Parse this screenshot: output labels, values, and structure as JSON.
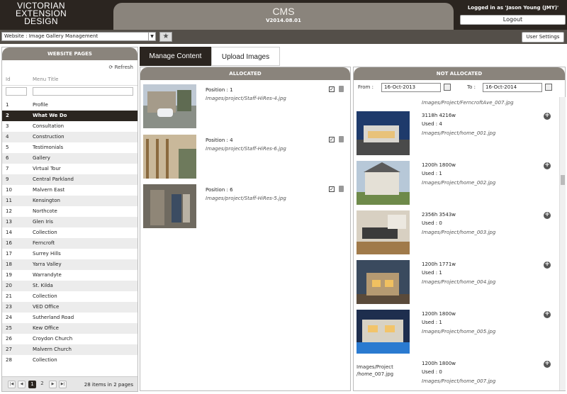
{
  "header": {
    "logo_lines": [
      "VICTORIAN",
      "EXTENSION",
      "DESIGN"
    ],
    "title": "CMS",
    "version": "V2014.08.01",
    "login_text": "Logged in as 'Jason Young (JMY)'",
    "logout_label": "Logout"
  },
  "toolbar": {
    "website_select": "Website : Image Gallery Management",
    "user_settings_label": "User Settings"
  },
  "left_panel": {
    "title": "WEBSITE PAGES",
    "refresh_label": "Refresh",
    "col_id": "Id",
    "col_title": "Menu Title",
    "rows": [
      {
        "id": "1",
        "title": "Profile"
      },
      {
        "id": "2",
        "title": "What We Do"
      },
      {
        "id": "3",
        "title": "Consultation"
      },
      {
        "id": "4",
        "title": "Construction"
      },
      {
        "id": "5",
        "title": "Testimonials"
      },
      {
        "id": "6",
        "title": "Gallery"
      },
      {
        "id": "7",
        "title": "Virtual Tour"
      },
      {
        "id": "9",
        "title": "Central Parkland"
      },
      {
        "id": "10",
        "title": "Malvern East"
      },
      {
        "id": "11",
        "title": "Kensington"
      },
      {
        "id": "12",
        "title": "Northcote"
      },
      {
        "id": "13",
        "title": "Glen Iris"
      },
      {
        "id": "14",
        "title": "Collection"
      },
      {
        "id": "16",
        "title": "Ferncroft"
      },
      {
        "id": "17",
        "title": "Surrey Hills"
      },
      {
        "id": "18",
        "title": "Yarra Valley"
      },
      {
        "id": "19",
        "title": "Warrandyte"
      },
      {
        "id": "20",
        "title": "St. Kilda"
      },
      {
        "id": "21",
        "title": "Collection"
      },
      {
        "id": "23",
        "title": "VED Office"
      },
      {
        "id": "24",
        "title": "Sutherland Road"
      },
      {
        "id": "25",
        "title": "Kew Office"
      },
      {
        "id": "26",
        "title": "Croydon Church"
      },
      {
        "id": "27",
        "title": "Malvern Church"
      },
      {
        "id": "28",
        "title": "Collection"
      }
    ],
    "selected_id": "2",
    "pager": {
      "pages": [
        "1",
        "2"
      ],
      "current": "1",
      "info": "28 items in 2 pages"
    }
  },
  "tabs": [
    {
      "label": "Manage Content"
    },
    {
      "label": "Upload Images"
    }
  ],
  "allocated": {
    "title": "ALLOCATED",
    "items": [
      {
        "position": "Position : 1",
        "path": "Images/project/Staff-HiRes-4.jpg"
      },
      {
        "position": "Position : 4",
        "path": "Images/project/Staff-HiRes-6.jpg"
      },
      {
        "position": "Position : 6",
        "path": "Images/project/Staff-HiRes-5.jpg"
      }
    ]
  },
  "not_allocated": {
    "title": "NOT ALLOCATED",
    "from_label": "From :",
    "from_date": "16-Oct-2013",
    "to_label": "To :",
    "to_date": "16-Oct-2014",
    "top_partial_path": "Images/Project/FerncroftAve_007.jpg",
    "items": [
      {
        "dims": "3118h 4216w",
        "used": "Used : 4",
        "path": "Images/Project/home_001.jpg"
      },
      {
        "dims": "1200h 1800w",
        "used": "Used : 1",
        "path": "Images/Project/home_002.jpg"
      },
      {
        "dims": "2356h 3543w",
        "used": "Used : 0",
        "path": "Images/Project/home_003.jpg"
      },
      {
        "dims": "1200h 1771w",
        "used": "Used : 1",
        "path": "Images/Project/home_004.jpg"
      },
      {
        "dims": "1200h 1800w",
        "used": "Used : 1",
        "path": "Images/Project/home_005.jpg"
      },
      {
        "dims": "1200h 1800w",
        "used": "Used : 0",
        "path": "Images/Project/home_007.jpg",
        "thumb_alt": "Images/Project /home_007.jpg"
      }
    ]
  }
}
